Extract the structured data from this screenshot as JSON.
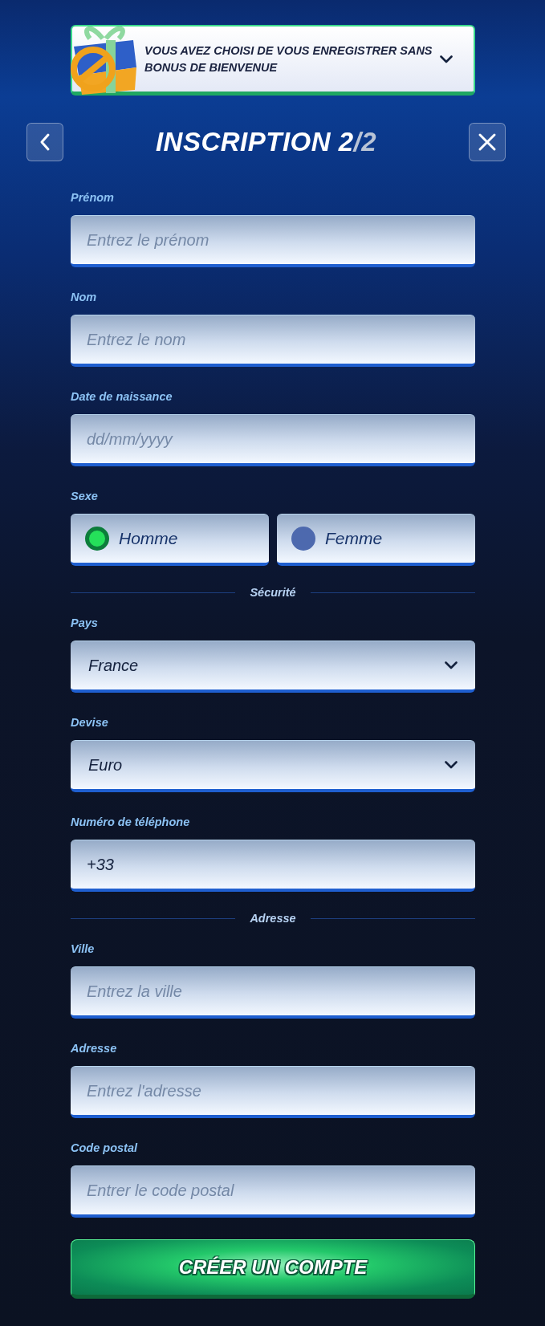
{
  "banner": {
    "text": "VOUS AVEZ CHOISI DE VOUS ENREGISTRER SANS BONUS DE BIENVENUE"
  },
  "header": {
    "title": "INSCRIPTION 2",
    "step_total": "/2"
  },
  "fields": [
    {
      "kind": "text",
      "label": "Prénom",
      "placeholder": "Entrez le prénom"
    },
    {
      "kind": "text",
      "label": "Nom",
      "placeholder": "Entrez le nom"
    },
    {
      "kind": "text",
      "label": "Date de naissance",
      "placeholder": "dd/mm/yyyy"
    },
    {
      "kind": "radio",
      "label": "Sexe",
      "options": [
        {
          "label": "Homme",
          "selected": true
        },
        {
          "label": "Femme",
          "selected": false
        }
      ]
    },
    {
      "kind": "divider",
      "label": "Sécurité"
    },
    {
      "kind": "select",
      "label": "Pays",
      "value": "France"
    },
    {
      "kind": "select",
      "label": "Devise",
      "value": "Euro"
    },
    {
      "kind": "value",
      "label": "Numéro de téléphone",
      "value": "+33"
    },
    {
      "kind": "divider",
      "label": "Adresse"
    },
    {
      "kind": "text",
      "label": "Ville",
      "placeholder": "Entrez la ville"
    },
    {
      "kind": "text",
      "label": "Adresse",
      "placeholder": "Entrez l'adresse"
    },
    {
      "kind": "text",
      "label": "Code postal",
      "placeholder": "Entrer le code postal"
    }
  ],
  "submit": {
    "label": "CRÉER UN COMPTE"
  }
}
